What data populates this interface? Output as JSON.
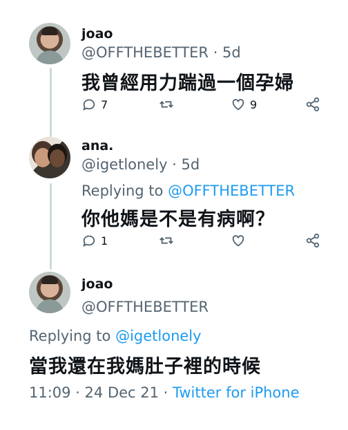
{
  "tweet1": {
    "name": "joao",
    "handle": "@OFFTHEBETTER · 5d",
    "text": "我曾經用力踹過一個孕婦",
    "reply_count": "7",
    "retweet_count": "",
    "like_count": "9"
  },
  "tweet2": {
    "name": "ana.",
    "handle": "@igetlonely · 5d",
    "replying_prefix": "Replying to ",
    "replying_to": "@OFFTHEBETTER",
    "text": "你他媽是不是有病啊？",
    "reply_count": "1",
    "retweet_count": "",
    "like_count": ""
  },
  "tweet3": {
    "name": "joao",
    "handle": "@OFFTHEBETTER",
    "replying_prefix": "Replying to ",
    "replying_to": "@igetlonely",
    "text": "當我還在我媽肚子裡的時候",
    "timestamp": "11:09 · 24 Dec 21 · ",
    "source": "Twitter for iPhone"
  },
  "icons": {
    "reply": "reply-icon",
    "retweet": "retweet-icon",
    "like": "heart-icon",
    "share": "share-icon"
  },
  "colors": {
    "link": "#1d9bf0",
    "secondary_text": "#536471",
    "thread_line": "#cfd9de"
  }
}
